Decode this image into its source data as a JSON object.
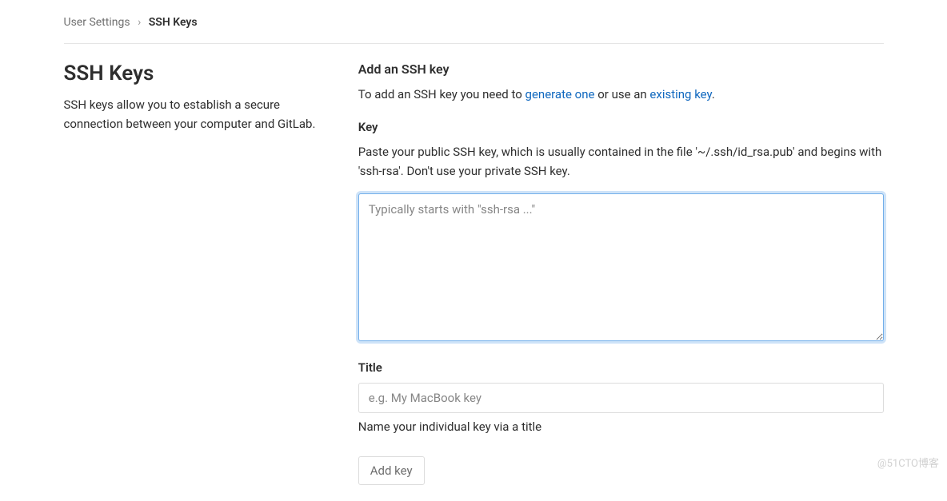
{
  "breadcrumb": {
    "parent": "User Settings",
    "current": "SSH Keys"
  },
  "left": {
    "title": "SSH Keys",
    "description": "SSH keys allow you to establish a secure connection between your computer and GitLab."
  },
  "right": {
    "add_heading": "Add an SSH key",
    "add_help_prefix": "To add an SSH key you need to ",
    "add_help_link1": "generate one",
    "add_help_mid": " or use an ",
    "add_help_link2": "existing key",
    "add_help_suffix": ".",
    "key_label": "Key",
    "key_desc": "Paste your public SSH key, which is usually contained in the file '~/.ssh/id_rsa.pub' and begins with 'ssh-rsa'. Don't use your private SSH key.",
    "key_placeholder": "Typically starts with \"ssh-rsa ...\"",
    "key_value": "",
    "title_label": "Title",
    "title_placeholder": "e.g. My MacBook key",
    "title_value": "",
    "title_hint": "Name your individual key via a title",
    "add_button": "Add key"
  },
  "watermark": "@51CTO博客"
}
